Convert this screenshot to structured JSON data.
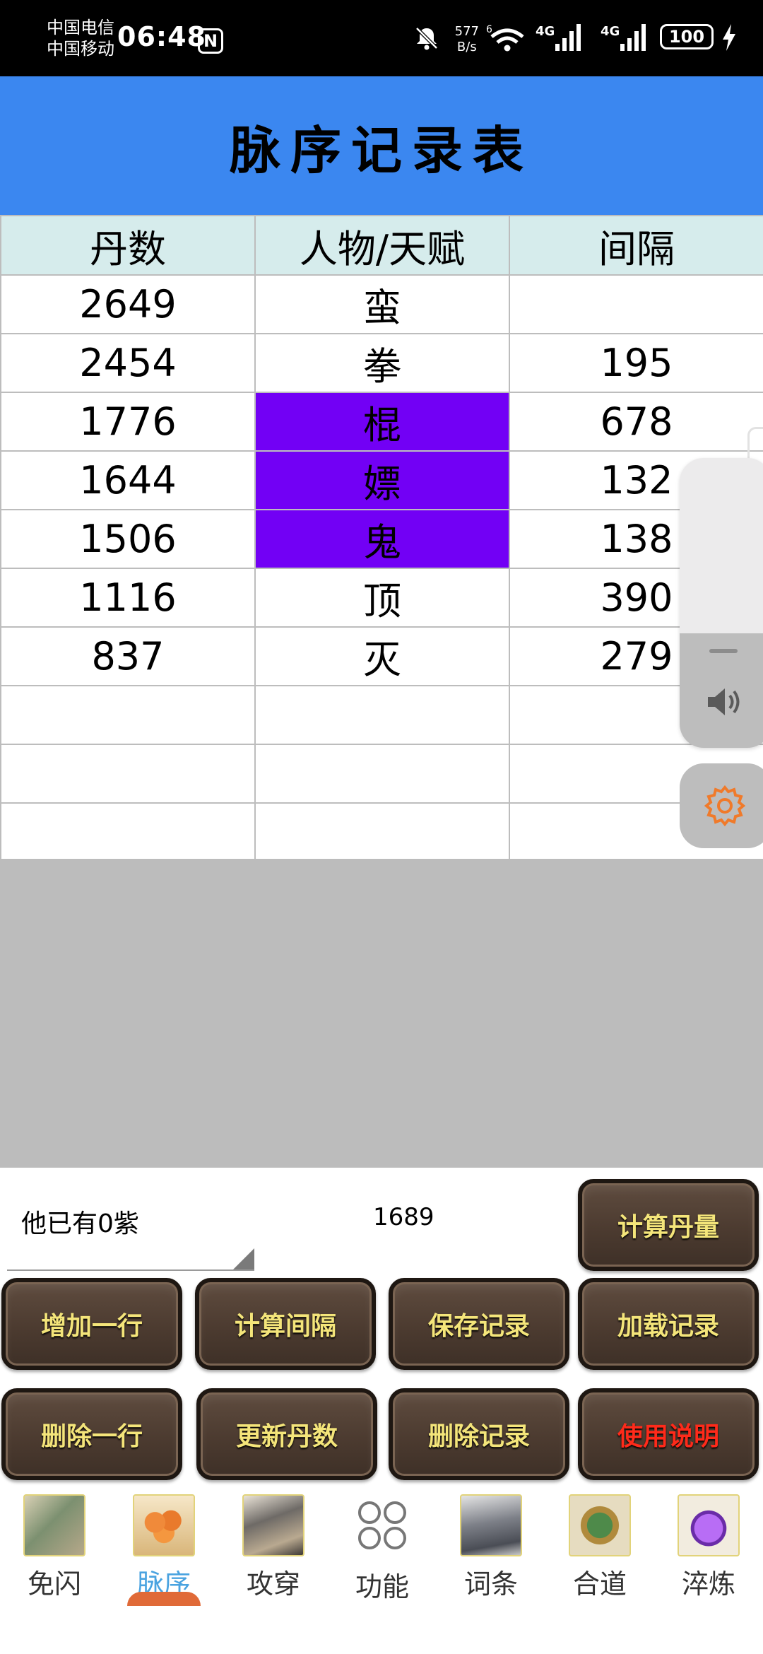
{
  "status_bar": {
    "carrier_line1": "中国电信",
    "carrier_line2": "中国移动",
    "time": "06:48",
    "nfc": "N",
    "net_speed_value": "577",
    "net_speed_unit": "B/s",
    "wifi_badge": "6",
    "signal1_label": "4G",
    "signal2_label": "4G",
    "battery": "100"
  },
  "header": {
    "title": "脉序记录表"
  },
  "table": {
    "columns": [
      "丹数",
      "人物/天赋",
      "间隔"
    ],
    "rows": [
      {
        "dan": "2649",
        "ren": "蛮",
        "jian": "",
        "highlight": false
      },
      {
        "dan": "2454",
        "ren": "拳",
        "jian": "195",
        "highlight": false
      },
      {
        "dan": "1776",
        "ren": "棍",
        "jian": "678",
        "highlight": true
      },
      {
        "dan": "1644",
        "ren": "嫖",
        "jian": "132",
        "highlight": true
      },
      {
        "dan": "1506",
        "ren": "鬼",
        "jian": "138",
        "highlight": true
      },
      {
        "dan": "1116",
        "ren": "顶",
        "jian": "390",
        "highlight": false
      },
      {
        "dan": "837",
        "ren": "灭",
        "jian": "279",
        "highlight": false
      },
      {
        "dan": "",
        "ren": "",
        "jian": "",
        "highlight": false
      },
      {
        "dan": "",
        "ren": "",
        "jian": "",
        "highlight": false
      },
      {
        "dan": "",
        "ren": "",
        "jian": "",
        "highlight": false
      }
    ],
    "highlight_color": "#7200f5"
  },
  "controls": {
    "selector_text": "他已有0紫",
    "value_text": "1689",
    "buttons": {
      "calc_dan": "计算丹量",
      "add_row": "增加一行",
      "calc_interval": "计算间隔",
      "save_record": "保存记录",
      "load_record": "加载记录",
      "delete_row": "删除一行",
      "update_dan": "更新丹数",
      "delete_record": "删除记录",
      "instructions": "使用说明"
    }
  },
  "nav": {
    "items": [
      {
        "label": "免闪",
        "icon": "crossed-arms-icon"
      },
      {
        "label": "脉序",
        "icon": "orbs-icon"
      },
      {
        "label": "攻穿",
        "icon": "warrior-icon"
      },
      {
        "label": "功能",
        "icon": "grid-circles-icon"
      },
      {
        "label": "词条",
        "icon": "knight-icon"
      },
      {
        "label": "合道",
        "icon": "seal-icon"
      },
      {
        "label": "淬炼",
        "icon": "gem-icon"
      }
    ],
    "active_index": 1,
    "active_color": "#4aa3e0"
  },
  "colors": {
    "header_bg": "#3b87f0",
    "table_header_bg": "#d6ecec",
    "button_text": "#f4e57a",
    "button_text_alert": "#ff2a1a"
  }
}
